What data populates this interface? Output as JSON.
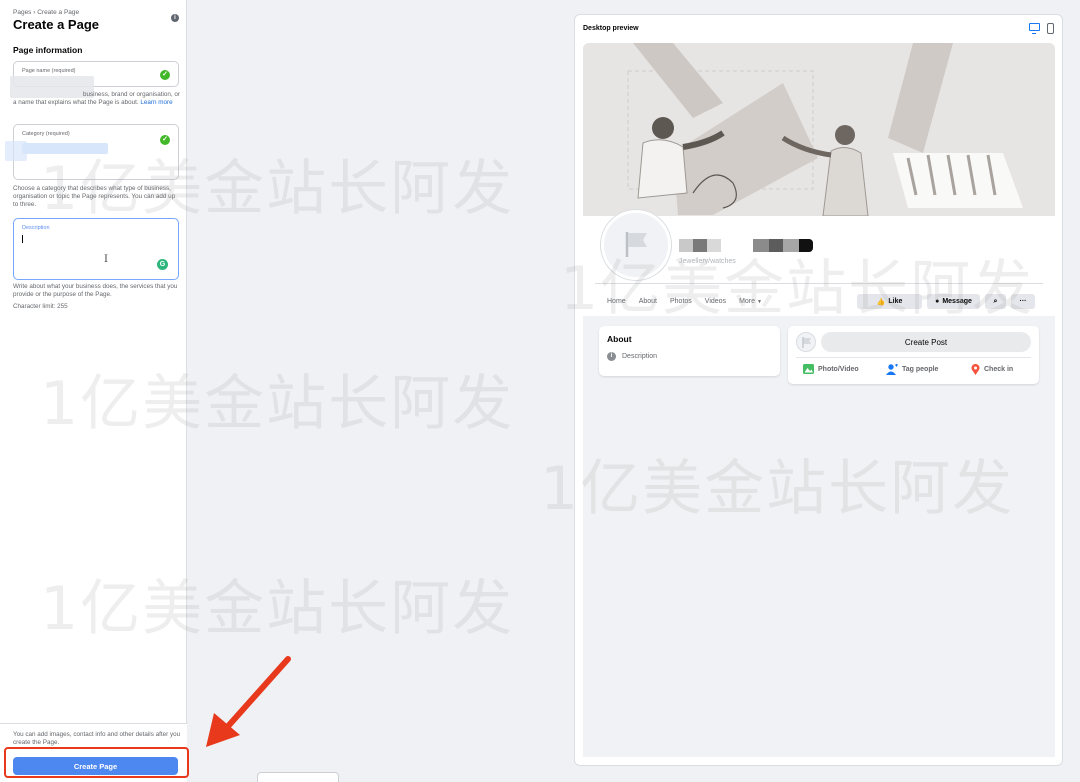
{
  "left_panel": {
    "breadcrumb": "Pages › Create a Page",
    "title": "Create a Page",
    "section_title": "Page information",
    "page_name": {
      "label": "Page name (required)",
      "helper": "business, brand or organisation, or a name that explains what the Page is about.",
      "helper_link": "Learn more"
    },
    "category": {
      "label": "Category (required)",
      "helper": "Choose a category that describes what type of business, organisation or topic the Page represents. You can add up to three."
    },
    "description": {
      "label": "Description",
      "helper": "Write about what your business does, the services that you provide or the purpose of the Page.",
      "char_limit": "Character limit: 255"
    },
    "footer_note": "You can add images, contact info and other details after you create the Page.",
    "create_button": "Create Page"
  },
  "preview": {
    "title": "Desktop preview",
    "icons": [
      "desktop-icon",
      "mobile-icon"
    ],
    "category_text": "Jewellery/watches",
    "tabs": [
      "Home",
      "About",
      "Photos",
      "Videos",
      "More"
    ],
    "buttons": {
      "like": "Like",
      "message": "Message"
    },
    "about": {
      "title": "About",
      "description": "Description"
    },
    "post": {
      "create_post": "Create Post",
      "photo_video": "Photo/Video",
      "tag_people": "Tag people",
      "check_in": "Check in"
    }
  },
  "watermark": "1亿美金站长阿发",
  "colors": {
    "accent_blue": "#1877f2",
    "button_blue": "#4d87f0",
    "check_green": "#42b72a",
    "highlight_red": "#e8391c"
  }
}
